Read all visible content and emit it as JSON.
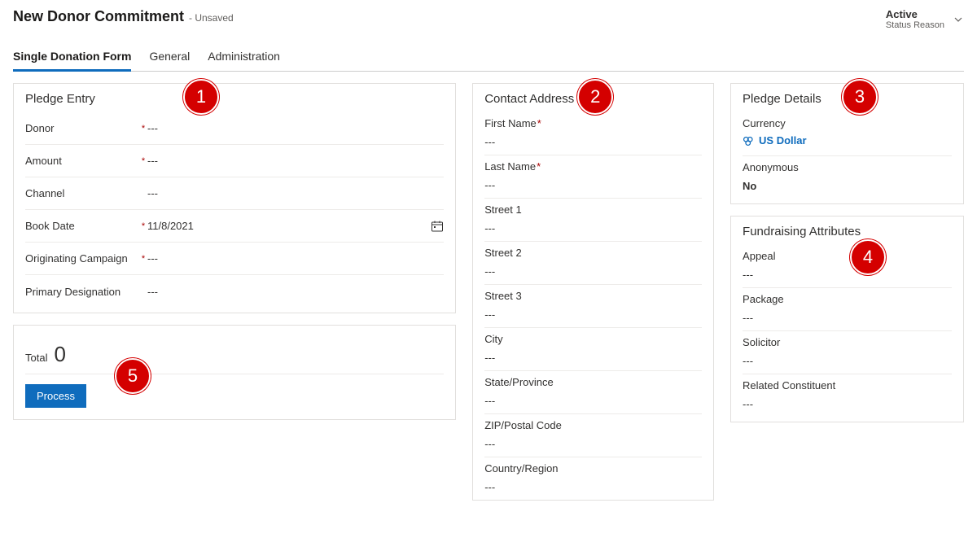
{
  "header": {
    "title": "New Donor Commitment",
    "unsaved": "- Unsaved",
    "status_value": "Active",
    "status_label": "Status Reason"
  },
  "tabs": [
    {
      "label": "Single Donation Form",
      "active": true
    },
    {
      "label": "General",
      "active": false
    },
    {
      "label": "Administration",
      "active": false
    }
  ],
  "pledge_entry": {
    "title": "Pledge Entry",
    "fields": {
      "donor": {
        "label": "Donor",
        "required": true,
        "value": "---"
      },
      "amount": {
        "label": "Amount",
        "required": true,
        "value": "---"
      },
      "channel": {
        "label": "Channel",
        "required": false,
        "value": "---"
      },
      "book_date": {
        "label": "Book Date",
        "required": true,
        "value": "11/8/2021"
      },
      "orig_campaign": {
        "label": "Originating Campaign",
        "required": true,
        "value": "---"
      },
      "primary_designation": {
        "label": "Primary Designation",
        "required": false,
        "value": "---"
      }
    }
  },
  "contact": {
    "title": "Contact Address",
    "first_name": {
      "label": "First Name",
      "required": true,
      "value": "---"
    },
    "last_name": {
      "label": "Last Name",
      "required": true,
      "value": "---"
    },
    "street1": {
      "label": "Street 1",
      "value": "---"
    },
    "street2": {
      "label": "Street 2",
      "value": "---"
    },
    "street3": {
      "label": "Street 3",
      "value": "---"
    },
    "city": {
      "label": "City",
      "value": "---"
    },
    "state": {
      "label": "State/Province",
      "value": "---"
    },
    "zip": {
      "label": "ZIP/Postal Code",
      "value": "---"
    },
    "country": {
      "label": "Country/Region",
      "value": "---"
    }
  },
  "pledge_details": {
    "title": "Pledge Details",
    "currency_label": "Currency",
    "currency_value": "US Dollar",
    "anonymous_label": "Anonymous",
    "anonymous_value": "No"
  },
  "fundraising": {
    "title": "Fundraising Attributes",
    "appeal": {
      "label": "Appeal",
      "value": "---"
    },
    "package": {
      "label": "Package",
      "value": "---"
    },
    "solicitor": {
      "label": "Solicitor",
      "value": "---"
    },
    "related": {
      "label": "Related Constituent",
      "value": "---"
    }
  },
  "total_section": {
    "label": "Total",
    "value": "0",
    "process": "Process"
  },
  "annotations": {
    "b1": "1",
    "b2": "2",
    "b3": "3",
    "b4": "4",
    "b5": "5"
  }
}
